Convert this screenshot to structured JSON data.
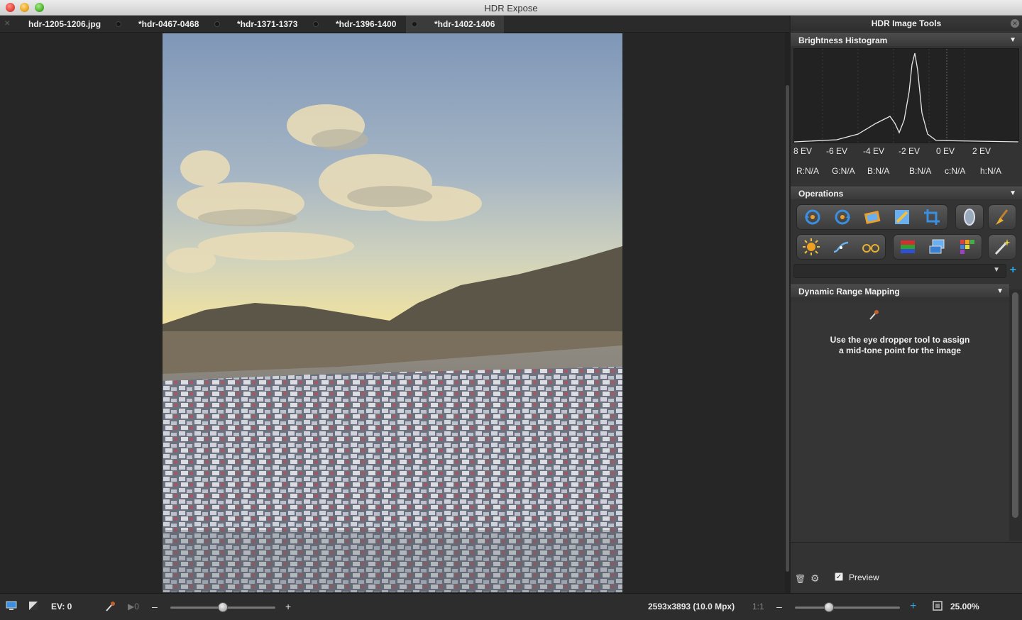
{
  "window": {
    "title": "HDR Expose"
  },
  "tabs": [
    {
      "label": "hdr-1205-1206.jpg",
      "icon": "close-x-icon"
    },
    {
      "label": "*hdr-0467-0468",
      "icon": "dot-icon"
    },
    {
      "label": "*hdr-1371-1373",
      "icon": "dot-icon"
    },
    {
      "label": "*hdr-1396-1400",
      "icon": "dot-icon"
    },
    {
      "label": "*hdr-1402-1406",
      "icon": "dot-icon",
      "active": true
    }
  ],
  "panel": {
    "title": "HDR Image Tools",
    "histogram": {
      "title": "Brightness Histogram",
      "ev_labels": [
        "8 EV",
        "-6 EV",
        "-4 EV",
        "-2 EV",
        "0 EV",
        "2 EV"
      ],
      "readouts": [
        "R:N/A",
        "G:N/A",
        "B:N/A",
        "B:N/A",
        "c:N/A",
        "h:N/A"
      ]
    },
    "operations": {
      "title": "Operations",
      "row1": [
        "rotate-left-icon",
        "rotate-right-icon",
        "picture-frame-icon",
        "edit-pencil-icon",
        "crop-icon",
        "lens-filter-icon",
        "broom-icon"
      ],
      "row2": [
        "sun-exposure-icon",
        "curve-icon",
        "glasses-icon",
        "color-bars-icon",
        "screen-adjust-icon",
        "color-grid-icon",
        "magic-wand-icon"
      ],
      "preset_value": "",
      "add_label": "+"
    },
    "drm": {
      "title": "Dynamic Range Mapping",
      "hint_line1": "Use the eye dropper tool to assign",
      "hint_line2": "a mid-tone point for the image"
    },
    "footer": {
      "preview_label": "Preview",
      "preview_checked": true
    }
  },
  "statusbar": {
    "ev": "EV: 0",
    "step_label": "0",
    "minus": "–",
    "plus": "+",
    "dimensions": "2593x3893 (10.0 Mpx)",
    "ratio": "1:1",
    "zoom": "25.00%"
  }
}
